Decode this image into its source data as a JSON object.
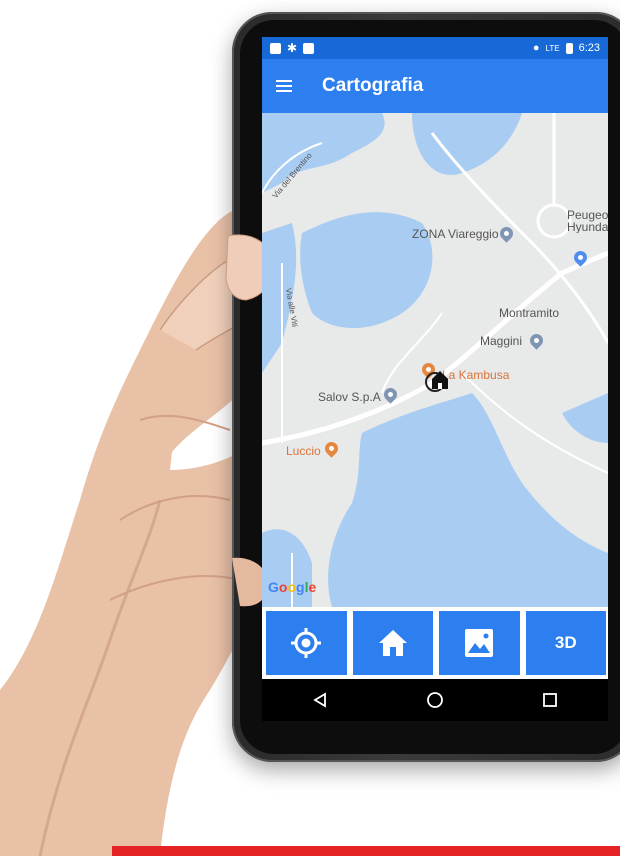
{
  "statusbar": {
    "time": "6:23",
    "signal_label": "LTE"
  },
  "appbar": {
    "title": "Cartografia"
  },
  "map": {
    "street_labels": [
      "Via del Brentino",
      "Via alle Viti"
    ],
    "pois": [
      {
        "name": "ZONA Viareggio",
        "kind": "grey"
      },
      {
        "name": "Peugeot Hyundai",
        "kind": "blue"
      },
      {
        "name": "Montramito",
        "kind": "area"
      },
      {
        "name": "Maggini",
        "kind": "grey"
      },
      {
        "name": "La Kambusa",
        "kind": "orange"
      },
      {
        "name": "Salov S.p.A",
        "kind": "grey"
      },
      {
        "name": "Luccio",
        "kind": "orange"
      }
    ],
    "attribution": "Google"
  },
  "actions": {
    "locate_icon": "crosshair-icon",
    "home_icon": "home-icon",
    "image_icon": "landscape-image-icon",
    "three_d_label": "3D"
  },
  "colors": {
    "primary": "#2d7ff0",
    "statusbar": "#1669d6",
    "water": "#a9cdf2",
    "accent_red": "#e52225"
  }
}
